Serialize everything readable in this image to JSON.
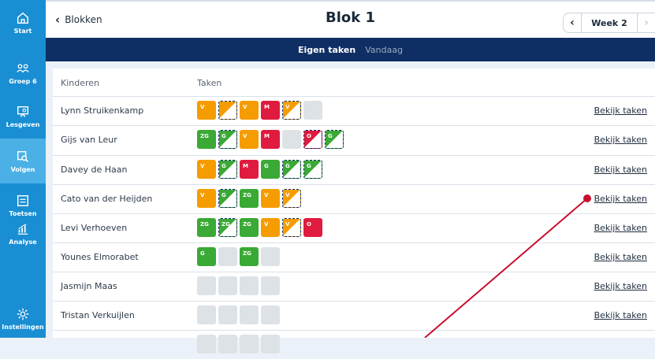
{
  "sidebar": {
    "items": [
      {
        "label": "Start",
        "icon": "home-icon",
        "active": false
      },
      {
        "label": "Groep 6",
        "icon": "group-icon",
        "active": false
      },
      {
        "label": "Lesgeven",
        "icon": "presentation-icon",
        "active": false
      },
      {
        "label": "Volgen",
        "icon": "monitor-search-icon",
        "active": true
      },
      {
        "label": "Toetsen",
        "icon": "test-icon",
        "active": false
      },
      {
        "label": "Analyse",
        "icon": "chart-icon",
        "active": false
      },
      {
        "label": "Instellingen",
        "icon": "gear-icon",
        "active": false
      }
    ]
  },
  "header": {
    "back_label": "Blokken",
    "title": "Blok 1",
    "week_label": "Week 2"
  },
  "subnav": {
    "tabs": [
      {
        "label": "Eigen taken",
        "active": true
      },
      {
        "label": "Vandaag",
        "active": false
      }
    ]
  },
  "table": {
    "col_kinderen": "Kinderen",
    "col_taken": "Taken",
    "link_label": "Bekijk taken",
    "rows": [
      {
        "name": "Lynn Struikenkamp",
        "tasks": [
          {
            "style": "orange",
            "label": "V"
          },
          {
            "style": "half-orange",
            "label": ""
          },
          {
            "style": "orange",
            "label": "V"
          },
          {
            "style": "red",
            "label": "M"
          },
          {
            "style": "half-orange",
            "label": "V"
          },
          {
            "style": "grey",
            "label": ""
          }
        ]
      },
      {
        "name": "Gijs van Leur",
        "tasks": [
          {
            "style": "green",
            "label": "ZG"
          },
          {
            "style": "half-green",
            "label": "G"
          },
          {
            "style": "orange",
            "label": "V"
          },
          {
            "style": "red",
            "label": "M"
          },
          {
            "style": "grey",
            "label": ""
          },
          {
            "style": "half-red",
            "label": "O"
          },
          {
            "style": "half-green",
            "label": "G"
          }
        ]
      },
      {
        "name": "Davey de Haan",
        "tasks": [
          {
            "style": "orange",
            "label": "V"
          },
          {
            "style": "half-green",
            "label": "G"
          },
          {
            "style": "red",
            "label": "M"
          },
          {
            "style": "green",
            "label": "G"
          },
          {
            "style": "half-green",
            "label": "G"
          },
          {
            "style": "half-green",
            "label": "G"
          }
        ]
      },
      {
        "name": "Cato van der Heijden",
        "tasks": [
          {
            "style": "orange",
            "label": "V"
          },
          {
            "style": "half-green",
            "label": "G"
          },
          {
            "style": "green",
            "label": "ZG"
          },
          {
            "style": "orange",
            "label": "V"
          },
          {
            "style": "half-orange",
            "label": "V"
          }
        ]
      },
      {
        "name": "Levi Verhoeven",
        "tasks": [
          {
            "style": "green",
            "label": "ZG"
          },
          {
            "style": "half-green",
            "label": "ZG"
          },
          {
            "style": "green",
            "label": "ZG"
          },
          {
            "style": "orange",
            "label": "V"
          },
          {
            "style": "half-orange",
            "label": "V"
          },
          {
            "style": "red",
            "label": "O"
          }
        ]
      },
      {
        "name": "Younes Elmorabet",
        "tasks": [
          {
            "style": "green",
            "label": "G"
          },
          {
            "style": "grey",
            "label": ""
          },
          {
            "style": "green",
            "label": "ZG"
          },
          {
            "style": "grey",
            "label": ""
          }
        ]
      },
      {
        "name": "Jasmijn Maas",
        "tasks": [
          {
            "style": "grey",
            "label": ""
          },
          {
            "style": "grey",
            "label": ""
          },
          {
            "style": "grey",
            "label": ""
          },
          {
            "style": "grey",
            "label": ""
          }
        ]
      },
      {
        "name": "Tristan Verkuijlen",
        "tasks": [
          {
            "style": "grey",
            "label": ""
          },
          {
            "style": "grey",
            "label": ""
          },
          {
            "style": "grey",
            "label": ""
          },
          {
            "style": "grey",
            "label": ""
          }
        ]
      },
      {
        "name": "",
        "tasks": [
          {
            "style": "grey",
            "label": ""
          },
          {
            "style": "grey",
            "label": ""
          },
          {
            "style": "grey",
            "label": ""
          },
          {
            "style": "grey",
            "label": ""
          }
        ]
      }
    ]
  },
  "colors": {
    "sidebar": "#1a8ed3",
    "sidebar_active": "#4ab0e6",
    "subnav": "#0f2e63",
    "orange": "#f59c00",
    "red": "#df1b3f",
    "green": "#3aa935",
    "grey": "#dde2e7",
    "annotation": "#c8102e"
  }
}
